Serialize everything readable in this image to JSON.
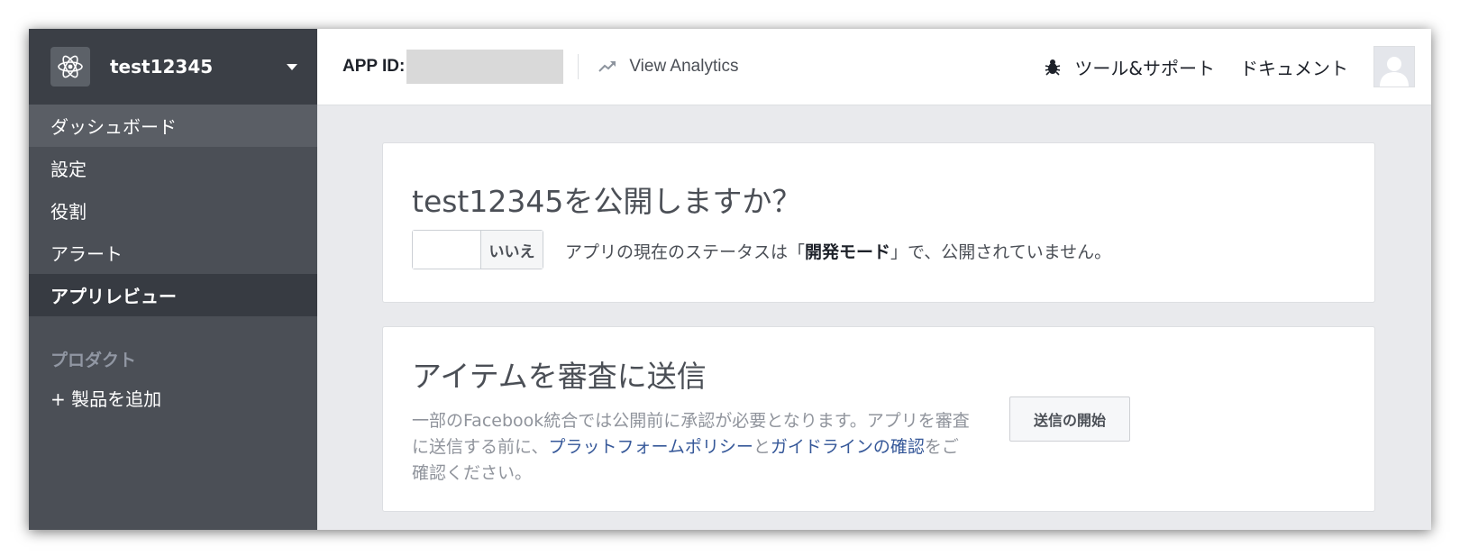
{
  "sidebar": {
    "app_name": "test12345",
    "items": [
      {
        "label": "ダッシュボード"
      },
      {
        "label": "設定"
      },
      {
        "label": "役割"
      },
      {
        "label": "アラート"
      },
      {
        "label": "アプリレビュー"
      }
    ],
    "section_label": "プロダクト",
    "add_product_label": "+ 製品を追加"
  },
  "topbar": {
    "app_id_label": "APP ID:",
    "analytics_label": "View Analytics",
    "tools_label": "ツール&サポート",
    "docs_label": "ドキュメント"
  },
  "publish_card": {
    "title": "test12345を公開しますか？",
    "toggle_label": "いいえ",
    "status_prefix": "アプリの現在のステータスは「",
    "status_mode": "開発モード",
    "status_suffix": "」で、公開されていません。"
  },
  "submit_card": {
    "title": "アイテムを審査に送信",
    "desc_part1": "一部のFacebook統合では公開前に承認が必要となります。アプリを審査に送信する前に、",
    "link_policy": "プラットフォームポリシー",
    "desc_part2": "と",
    "link_guidelines": "ガイドラインの確認",
    "desc_part3": "をご確認ください。",
    "button_label": "送信の開始"
  },
  "colors": {
    "sidebar_bg": "#4b4f56",
    "link": "#365899",
    "page_bg": "#e9eaed"
  }
}
